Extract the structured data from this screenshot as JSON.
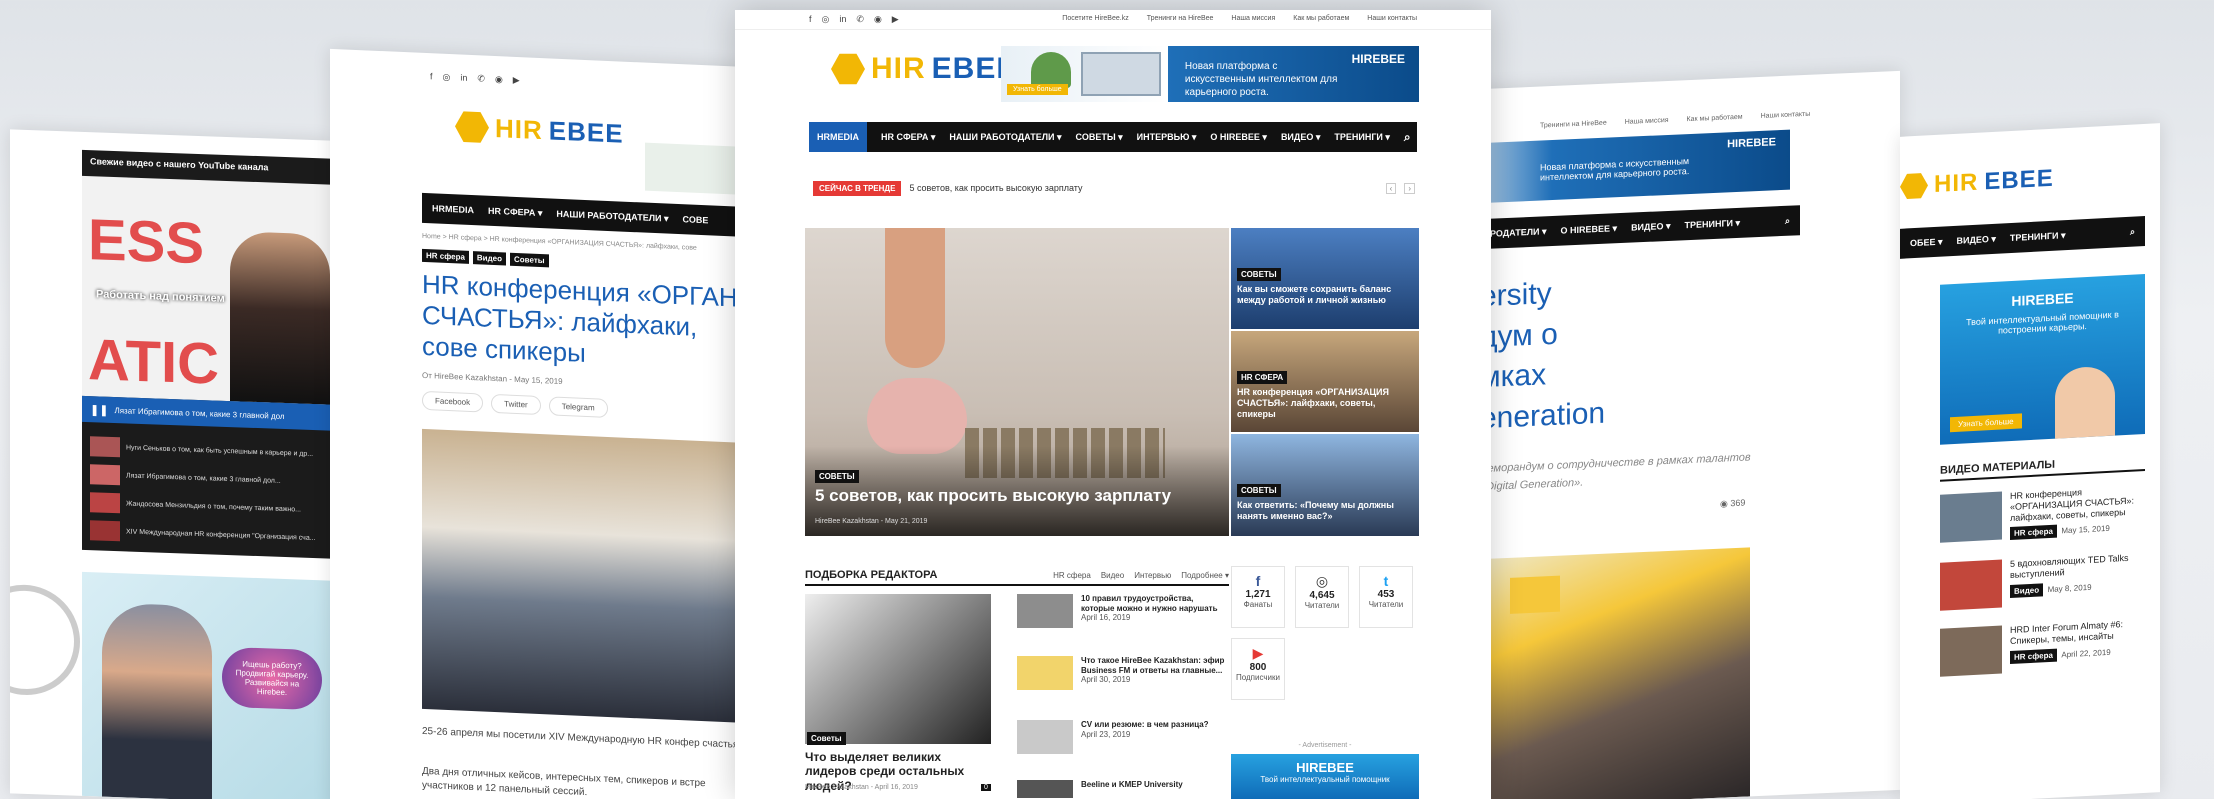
{
  "brand": {
    "hi": "HIR",
    "bee": "EBEE",
    "small_hi": "HIR",
    "small_bee": "EBEE"
  },
  "center": {
    "toplinks": [
      "Поcетите HireBee.kz",
      "Тренинги на HireBee",
      "Наша миссия",
      "Как мы работаем",
      "Наши контакты"
    ],
    "social_icons": [
      "f",
      "◎",
      "in",
      "✆",
      "◉",
      "▶"
    ],
    "ad_text": "Новая платформа с искусственным интеллектом для карьерного роста.",
    "ad_btn": "Узнать больше",
    "nav": [
      "HRMEDIA",
      "HR СФЕРА ▾",
      "НАШИ РАБОТОДАТЕЛИ ▾",
      "СОВЕТЫ ▾",
      "ИНТЕРВЬЮ ▾",
      "О HIREBEE ▾",
      "ВИДЕО ▾",
      "ТРЕНИНГИ ▾"
    ],
    "trending_label": "СЕЙЧАС В ТРЕНДЕ",
    "trending_text": "5 советов, как просить высокую зарплату",
    "hero": {
      "tag": "СОВЕТЫ",
      "title": "5 советов, как просить высокую зарплату",
      "meta": "HireBee Kazakhstan  -  May 21, 2019"
    },
    "side": [
      {
        "tag": "СОВЕТЫ",
        "title": "Как вы сможете сохранить баланс между работой и личной жизнью"
      },
      {
        "tag": "HR СФЕРА",
        "title": "HR конференция «ОРГАНИЗАЦИЯ СЧАСТЬЯ»: лайфхаки, советы, спикеры"
      },
      {
        "tag": "СОВЕТЫ",
        "title": "Как ответить: «Почему мы должны нанять именно вас?»"
      }
    ],
    "editor": {
      "title": "ПОДБОРКА РЕДАКТОРА",
      "filters": [
        "HR сфера",
        "Видео",
        "Интервью",
        "Подробнее ▾"
      ],
      "main_tag": "Советы",
      "main_title": "Что выделяет великих лидеров среди остальных людей?",
      "main_meta": "HireBee Kazakhstan  -  April 16, 2019",
      "main_count": "0",
      "list": [
        {
          "title": "10 правил трудоустройства, которые можно и нужно нарушать",
          "date": "April 16, 2019"
        },
        {
          "title": "Что такое HireBee Kazakhstan: эфир Business FM и ответы на главные...",
          "date": "April 30, 2019"
        },
        {
          "title": "CV или резюме: в чем разница?",
          "date": "April 23, 2019"
        },
        {
          "title": "Beeline и KMEP University",
          "date": ""
        }
      ]
    },
    "stats": [
      {
        "icon": "f",
        "num": "1,271",
        "lbl": "Фанаты"
      },
      {
        "icon": "◎",
        "num": "4,645",
        "lbl": "Читатели"
      },
      {
        "icon": "t",
        "num": "453",
        "lbl": "Читатели"
      },
      {
        "icon": "▶",
        "num": "800",
        "lbl": "Подписчики"
      }
    ],
    "advert": "- Advertisement -",
    "advert_sub": "Твой интеллектуальный помощник"
  },
  "left2": {
    "nav": [
      "HRMEDIA",
      "HR СФЕРА ▾",
      "НАШИ РАБОТОДАТЕЛИ ▾",
      "СОВЕ"
    ],
    "crumb": "Home  >  HR сфера  >  HR конференция «ОРГАНИЗАЦИЯ СЧАСТЬЯ»: лайфхаки, сове",
    "tags": [
      "HR сфера",
      "Видео",
      "Советы"
    ],
    "title": "HR конференция «ОРГАН СЧАСТЬЯ»: лайфхаки, сове спикеры",
    "byline": "От HireBee Kazakhstan  -  May 15, 2019",
    "share": [
      "Facebook",
      "Twitter",
      "Telegram"
    ],
    "para1": "25-26 апреля мы посетили XIV Международную HR конфер счастья\".",
    "para2": "Два дня отличных кейсов, интересных тем, спикеров и встре участников и 12 панельный сессий."
  },
  "left1": {
    "header": "Свежие видео с нашего YouTube канала",
    "big1": "ESS",
    "big2": "ATIC",
    "overlay": "Работать над понятием",
    "player": "Лязат Ибрагимова о том, какие 3 главной дол",
    "items": [
      "Нуги Сеньков о том, как быть успешным в карьере и др...",
      "Лязат Ибрагимова о том, какие 3 главной дол...",
      "Жандосова Мензильдия о том, почему таким важно...",
      "XIV Международная HR конференция \"Организация сча..."
    ],
    "bubble": "Ищешь работу? Продвигай карьеру. Развивайся на Hirebee."
  },
  "right1": {
    "toplinks": [
      "Тренинги на HireBee",
      "Наша миссия",
      "Как мы работаем",
      "Наши контакты"
    ],
    "ad_text": "Новая платформа с искусственным интеллектом для карьерного роста.",
    "nav": [
      "РОДАТЕЛИ ▾",
      "О HIREBEE ▾",
      "ВИДЕО ▾",
      "ТРЕНИНГИ ▾"
    ],
    "title": "ersity дум о мках eneration",
    "title_lines": [
      "ersity",
      "дум о",
      "мках",
      "eneration"
    ],
    "sub": "меморандум о сотрудничестве в рамках талантов «Digital Generation».",
    "views": "369"
  },
  "right2": {
    "nav": [
      "ОБЕЕ ▾",
      "ВИДЕО ▾",
      "ТРЕНИНГИ ▾"
    ],
    "ad_text": "Твой интеллектуальный помощник в построении карьеры.",
    "ad_btn": "Узнать больше",
    "section": "ВИДЕО МАТЕРИАЛЫ",
    "items": [
      {
        "title": "HR конференция «ОРГАНИЗАЦИЯ СЧАСТЬЯ»: лайфхаки, советы, спикеры",
        "tag": "HR сфера",
        "date": "May 15, 2019"
      },
      {
        "title": "5 вдохновляющих TED Talks выступлений",
        "tag": "Видео",
        "date": "May 8, 2019"
      },
      {
        "title": "HRD Inter Forum Almaty #6: Спикеры, темы, инсайты",
        "tag": "HR сфера",
        "date": "April 22, 2019"
      }
    ]
  }
}
